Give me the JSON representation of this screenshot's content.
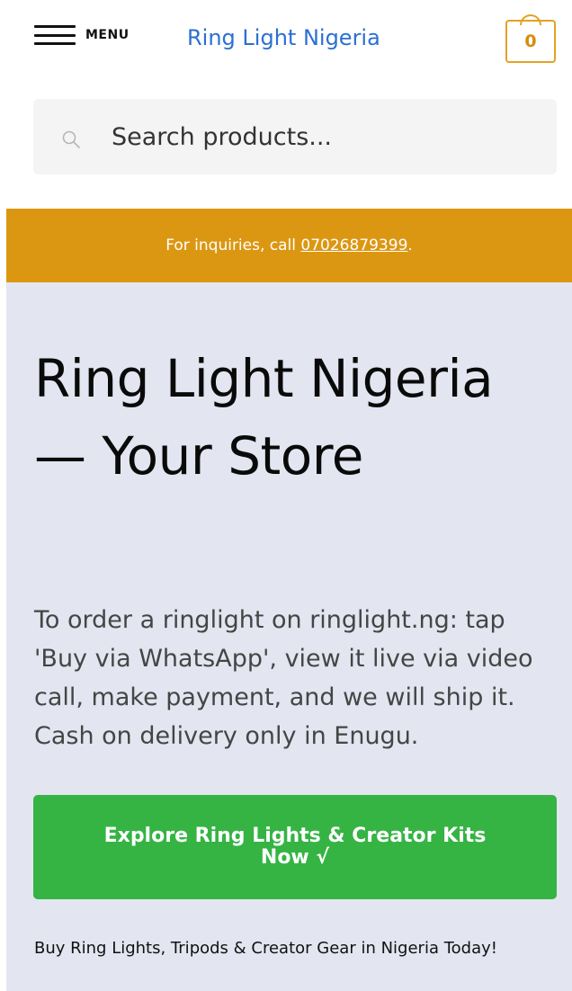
{
  "header": {
    "menu_label": "MENU",
    "site_title": "Ring Light Nigeria",
    "cart_count": "0"
  },
  "search": {
    "placeholder": "Search products..."
  },
  "banner": {
    "text": "For inquiries, call ",
    "phone": "07026879399",
    "suffix": "."
  },
  "hero": {
    "title": "Ring Light Nigeria — Your Store",
    "text": "To order a ringlight on ringlight.ng: tap 'Buy via WhatsApp', view it live via video call, make payment, and we will ship it. Cash on delivery only in Enugu.",
    "cta_label": "Explore Ring Lights & Creator Kits Now √",
    "tagline": "Buy Ring Lights, Tripods & Creator Gear in Nigeria Today!"
  },
  "colors": {
    "accent": "#dc9712",
    "link": "#2c6fd1",
    "cta": "#35b444",
    "hero_bg": "#e3e6f0"
  },
  "icons": {
    "menu": "hamburger-icon",
    "cart": "cart-bag-icon",
    "search": "search-icon"
  }
}
